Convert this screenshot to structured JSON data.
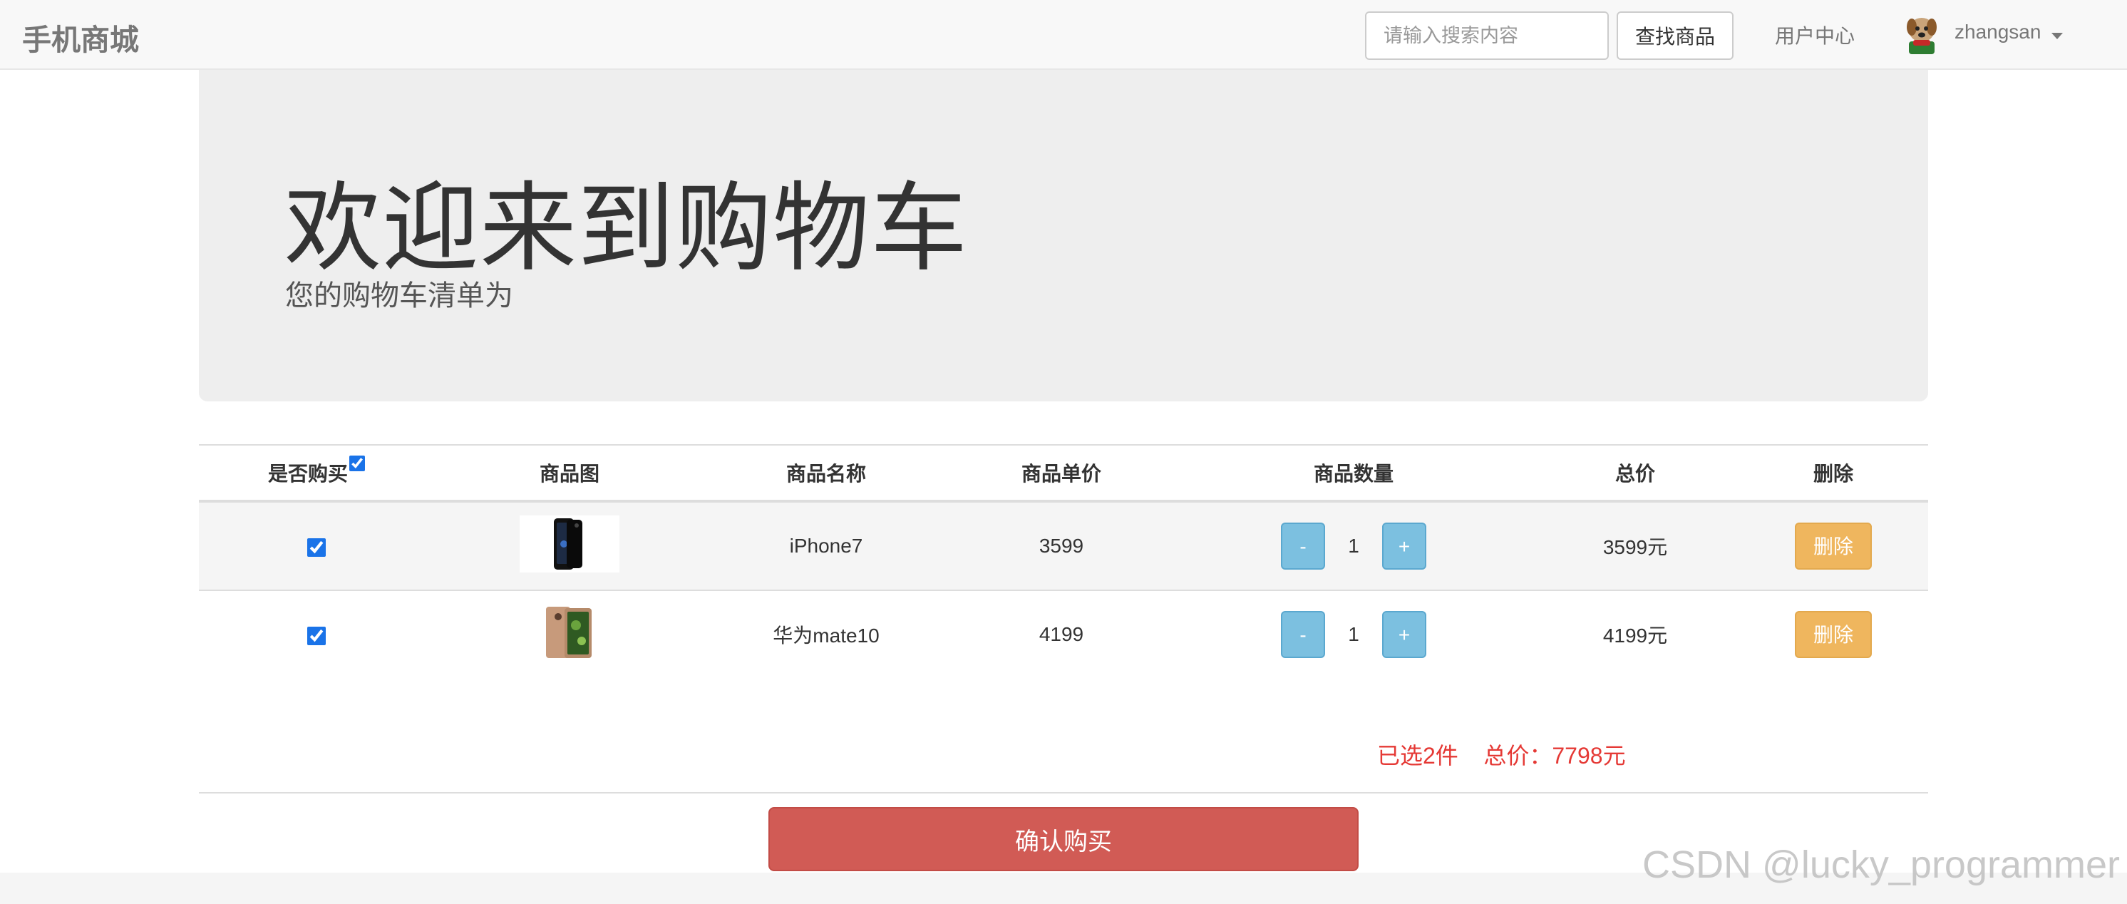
{
  "navbar": {
    "brand": "手机商城",
    "search_placeholder": "请输入搜索内容",
    "search_button": "查找商品",
    "user_center": "用户中心",
    "username": "zhangsan"
  },
  "jumbotron": {
    "title": "欢迎来到购物车",
    "subtitle": "您的购物车清单为"
  },
  "table": {
    "headers": [
      "是否购买",
      "商品图",
      "商品名称",
      "商品单价",
      "商品数量",
      "总价",
      "删除"
    ],
    "rows": [
      {
        "checked": true,
        "name": "iPhone7",
        "price": "3599",
        "quantity": "1",
        "total": "3599元",
        "minus": "-",
        "plus": "+",
        "delete": "删除",
        "image": "phone-black-icon"
      },
      {
        "checked": true,
        "name": "华为mate10",
        "price": "4199",
        "quantity": "1",
        "total": "4199元",
        "minus": "-",
        "plus": "+",
        "delete": "删除",
        "image": "phone-gold-icon"
      }
    ]
  },
  "summary": {
    "selected": "已选2件",
    "total": "总价：7798元"
  },
  "confirm_button": "确认购买",
  "watermark": "CSDN @lucky_programmer",
  "colors": {
    "accent_red": "#e53935",
    "confirm_bg": "#d15b55",
    "qty_button": "#7cc0e0",
    "delete_button": "#efb65e",
    "jumbotron_bg": "#eeeeee"
  }
}
